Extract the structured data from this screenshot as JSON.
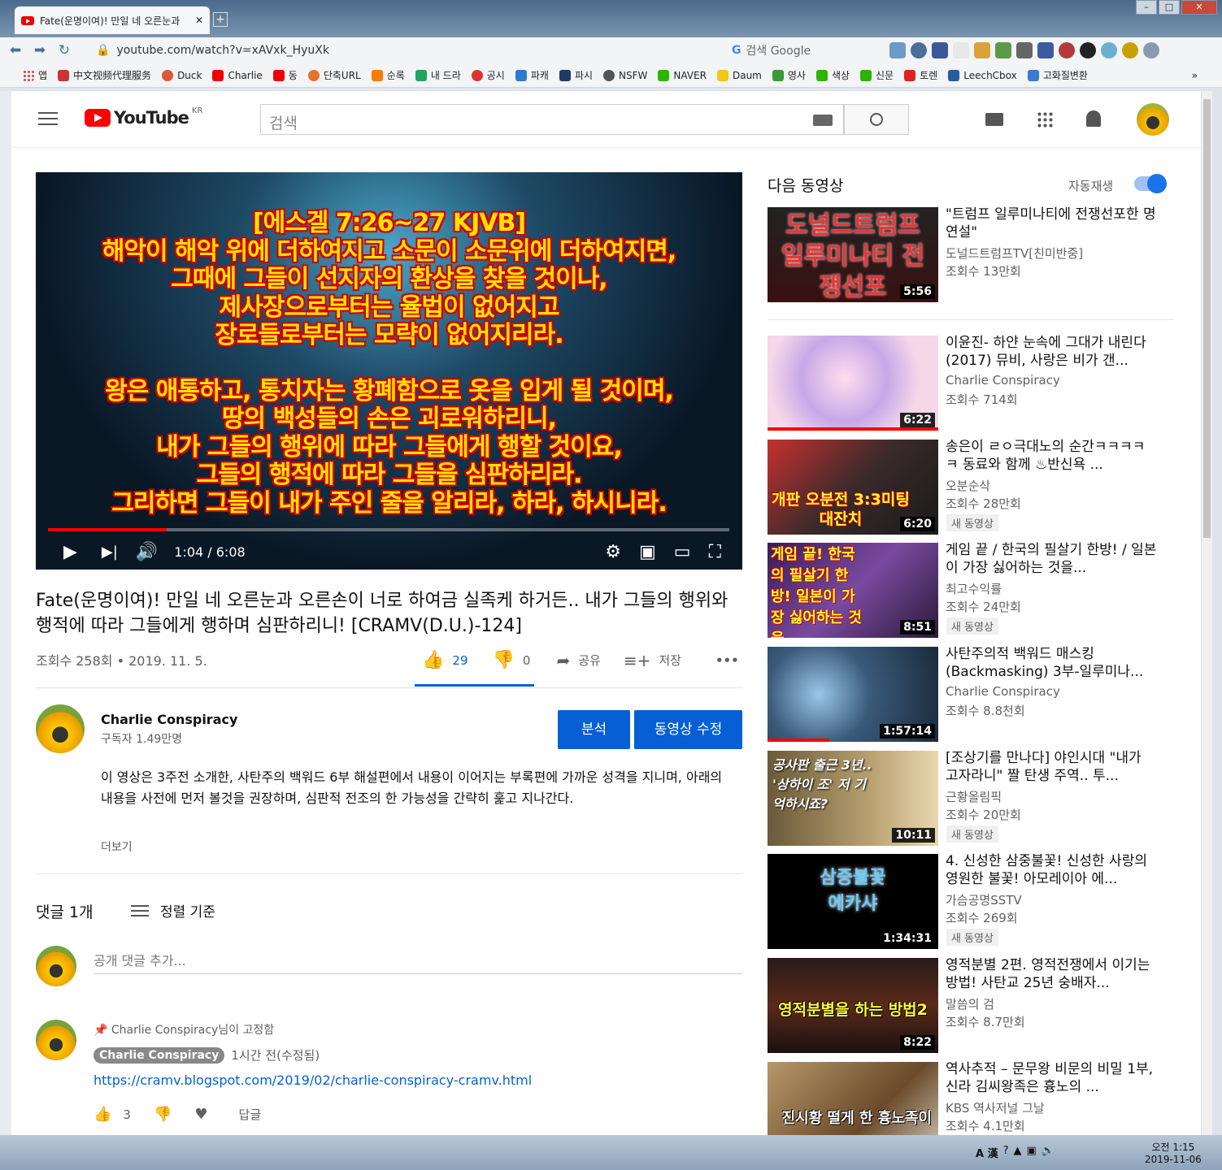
{
  "browser": {
    "tab_title": "Fate(운명이여)! 만일 네 오른눈과",
    "tab_close": "✕",
    "new_tab": "+",
    "url": "youtube.com/watch?v=xAVxk_HyuXk",
    "search_engine": "검색 Google",
    "bookmarks": [
      "앱",
      "中文视频代理服务",
      "Duck",
      "Charlie",
      "동",
      "단축URL",
      "순록",
      "내 드라",
      "공시",
      "파캐",
      "파시",
      "NSFW",
      "NAVER",
      "Daum",
      "영사",
      "색상",
      "신문",
      "토렌",
      "LeechCbox",
      "고화질변환"
    ],
    "bookmark_more": "»"
  },
  "header": {
    "logo": "YouTube",
    "region": "KR",
    "search_placeholder": "검색"
  },
  "video": {
    "overlay_lines": [
      "[에스겔 7:26~27 KJVB]",
      "해악이 해악 위에 더하여지고 소문이 소문위에 더하여지면,",
      "그때에 그들이 선지자의 환상을 찾을 것이나,",
      "제사장으로부터는 율법이 없어지고",
      "장로들로부터는 모략이 없어지리라.",
      "",
      "왕은 애통하고, 통치자는 황폐함으로 옷을 입게 될 것이며,",
      "땅의 백성들의 손은 괴로워하리니,",
      "내가 그들의 행위에 따라 그들에게 행할 것이요,",
      "그들의 행적에 따라 그들을 심판하리라.",
      "그리하면 그들이 내가 주인 줄을 알리라, 하라, 하시니라."
    ],
    "time": "1:04 / 6:08",
    "progress": 0.174,
    "title": "Fate(운명이여)! 만일 네 오른눈과 오른손이 너로 하여금 실족케 하거든.. 내가 그들의 행위와 행적에 따라 그들에게 행하며 심판하리니! [CRAMV(D.U.)-124]",
    "meta": "조회수 258회 • 2019. 11. 5.",
    "likes": "29",
    "dislikes": "0",
    "share": "공유",
    "save": "저장",
    "more": "•••"
  },
  "channel": {
    "name": "Charlie Conspiracy",
    "subs": "구독자 1.49만명",
    "analytics_btn": "분석",
    "edit_btn": "동영상 수정",
    "description": "이 영상은 3주전 소개한, 사탄주의 백워드 6부 해설편에서 내용이 이어지는 부록편에 가까운 성격을 지니며, 아래의 내용을 사전에 먼저 볼것을 권장하며, 심판적 전조의 한 가능성을 간략히 훑고 지나간다.",
    "show_more": "더보기"
  },
  "comments": {
    "count": "댓글 1개",
    "sort": "정렬 기준",
    "input_placeholder": "공개 댓글 추가...",
    "pinned": "Charlie Conspiracy님이 고정함",
    "author": "Charlie Conspiracy",
    "time": "1시간 전(수정됨)",
    "link": "https://cramv.blogspot.com/2019/02/charlie-conspiracy-cramv.html",
    "likes": "3",
    "reply": "답글"
  },
  "sidebar": {
    "up_next": "다음 동영상",
    "autoplay": "자동재생",
    "new_badge": "새 동영상",
    "items": [
      {
        "title": "\"트럼프 일루미나티에 전쟁선포한 명연설\"",
        "channel": "도널드트럼프TV[친미반중]",
        "views": "조회수 13만회",
        "duration": "5:56",
        "thumb_text": "도널드트럼프 일루미나티 전쟁선포",
        "new": false
      },
      {
        "title": "이윤진- 하얀 눈속에 그대가 내린다 (2017) 뮤비, 사랑은 비가 갠...",
        "channel": "Charlie Conspiracy",
        "views": "조회수 714회",
        "duration": "6:22",
        "thumb_text": "",
        "new": false
      },
      {
        "title": "송은이 ㄹㅇ극대노의 순간ㅋㅋㅋㅋㅋ 동료와 함께 ♨반신욕 ...",
        "channel": "오분순삭",
        "views": "조회수 28만회",
        "duration": "6:20",
        "thumb_text": "개판 오분전 3:3미팅대잔치",
        "new": true
      },
      {
        "title": "게임 끝 / 한국의 필살기 한방! / 일본이 가장 싫어하는 것을...",
        "channel": "최고수익률",
        "views": "조회수 24만회",
        "duration": "8:51",
        "thumb_text": "게임 끝! 한국의 필살기 한방! 일본이 가장 싫어하는 것을...",
        "new": true
      },
      {
        "title": "사탄주의적 백워드 매스킹 (Backmasking) 3부-일루미나...",
        "channel": "Charlie Conspiracy",
        "views": "조회수 8.8천회",
        "duration": "1:57:14",
        "thumb_text": "",
        "new": false
      },
      {
        "title": "[조상기를 만나다] 야인시대 \"내가 고자라니\" 짤 탄생 주역.. 투...",
        "channel": "근황올림픽",
        "views": "조회수 20만회",
        "duration": "10:11",
        "thumb_text": "공사판 출근 3년.. '상하이 조' 저 기억하시죠?",
        "new": true
      },
      {
        "title": "4. 신성한 삼중불꽃! 신성한 사랑의 영원한 불꽃! 아모레이아 에...",
        "channel": "가슴공명SSTV",
        "views": "조회수 269회",
        "duration": "1:34:31",
        "thumb_text": "삼중불꽃 에카샤",
        "new": true
      },
      {
        "title": "영적분별 2편. 영적전쟁에서 이기는 방법! 사탄교 25년 숭배자...",
        "channel": "말씀의 검",
        "views": "조회수 8.7만회",
        "duration": "8:22",
        "thumb_text": "영적분별을 하는 방법2",
        "new": false
      },
      {
        "title": "역사추적 – 문무왕 비문의 비밀 1부, 신라 김씨왕족은 흉노의 ...",
        "channel": "KBS 역사저널 그날",
        "views": "조회수 4.1만회",
        "duration": "",
        "thumb_text": "진시황 떨게 한 흉노족이",
        "new": false
      }
    ]
  },
  "taskbar": {
    "ime": "A 漢",
    "clock_time": "오전 1:15",
    "clock_date": "2019-11-06"
  },
  "colors": {
    "youtube_red": "#ff0000",
    "accent_blue": "#065fd4",
    "overlay_text": "#ffe400"
  }
}
